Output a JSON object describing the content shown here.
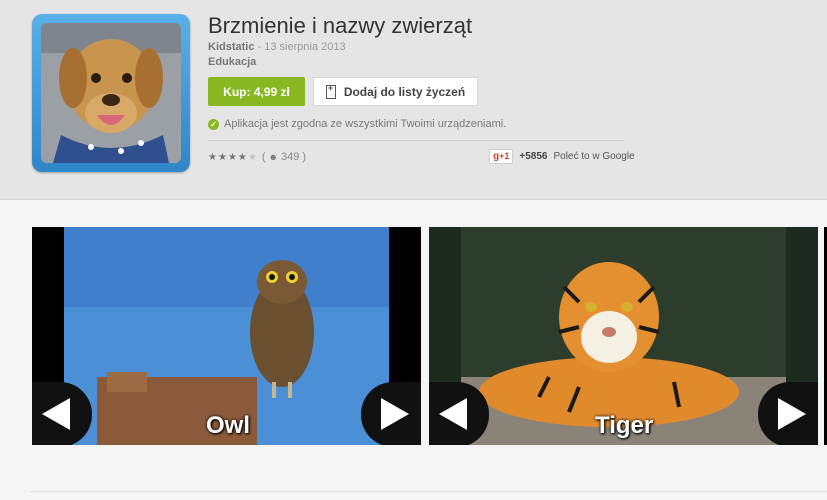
{
  "app": {
    "title": "Brzmienie i nazwy zwierząt",
    "developer": "Kidstatic",
    "date_sep": " - 13 sierpnia 2013",
    "category": "Edukacja"
  },
  "actions": {
    "buy_label": "Kup: 4,99 zł",
    "wishlist_label": "Dodaj do listy życzeń"
  },
  "compat": {
    "text": "Aplikacja jest zgodna ze wszystkimi Twoimi urządzeniami."
  },
  "rating": {
    "stars": 4,
    "max": 5,
    "count": "349",
    "open": "(",
    "close": ")"
  },
  "social": {
    "plus_label": "+1",
    "plus_count": "+5856",
    "recommend": "Poleć to w Google"
  },
  "screenshots": [
    {
      "caption": "Owl"
    },
    {
      "caption": "Tiger"
    }
  ],
  "icons": [
    "bookmark-plus-icon",
    "check-circle-icon",
    "star-icon",
    "user-icon",
    "google-plus-icon",
    "arrow-left-icon",
    "arrow-right-icon"
  ],
  "colors": {
    "buy_green": "#8ab823",
    "header_bg": "#e5e5e5",
    "gplus_red": "#d73d32"
  }
}
